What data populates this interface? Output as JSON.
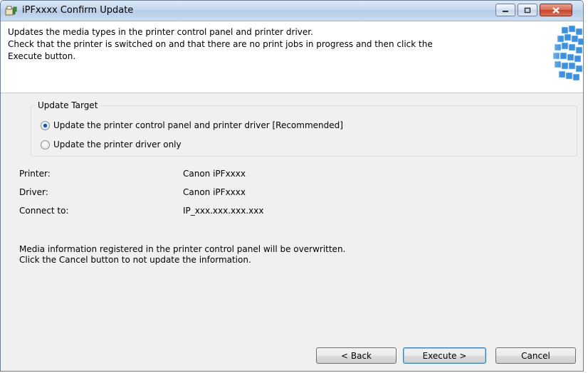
{
  "window": {
    "title": "iPFxxxx Confirm Update"
  },
  "header": {
    "line1": "Updates the media types in the printer control panel and printer driver.",
    "line2": "Check that the printer is switched on and that there are no print jobs in progress and then click the",
    "line3": "Execute button."
  },
  "update_target": {
    "title": "Update Target",
    "options": [
      {
        "label": "Update the printer control panel and printer driver [Recommended]",
        "selected": true
      },
      {
        "label": "Update the printer driver only",
        "selected": false
      }
    ]
  },
  "info": {
    "printer_label": "Printer:",
    "printer_value": "Canon iPFxxxx",
    "driver_label": "Driver:",
    "driver_value": "Canon iPFxxxx",
    "connect_label": "Connect to:",
    "connect_value": "IP_xxx.xxx.xxx.xxx"
  },
  "note": {
    "line1": "Media information registered in the printer control panel will be overwritten.",
    "line2": "Click the Cancel button to not update the information."
  },
  "buttons": {
    "back": "< Back",
    "execute": "Execute >",
    "cancel": "Cancel"
  },
  "icons": {
    "app": "printer-install-icon",
    "header_art": "media-blocks-graphic"
  }
}
